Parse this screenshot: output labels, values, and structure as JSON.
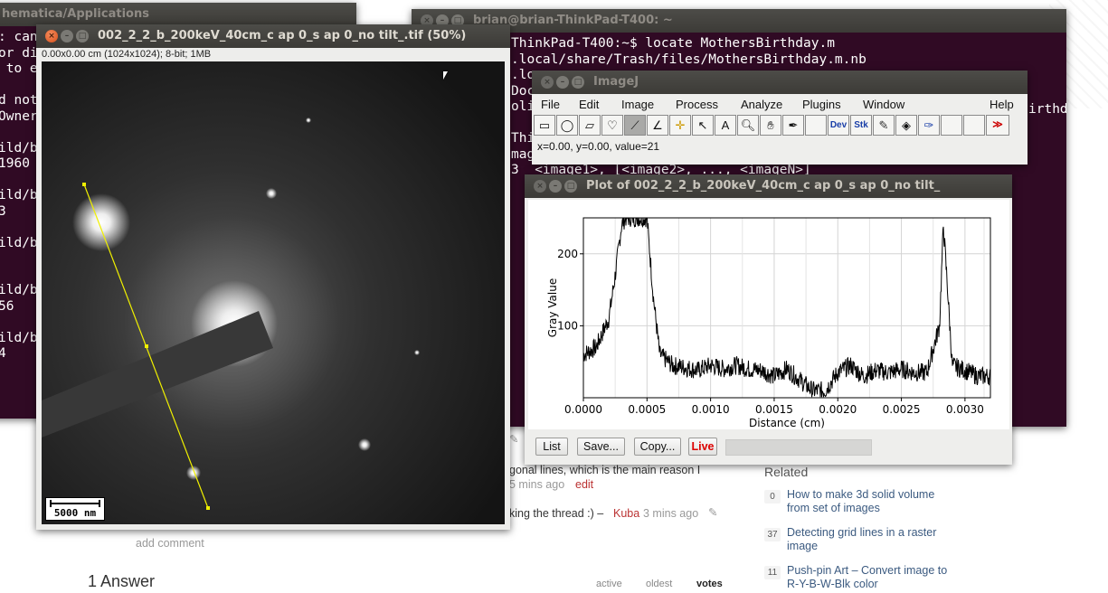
{
  "web": {
    "comment_fragment_1": "gonal lines, which is the main reason I",
    "comment_time_1": "5 mins ago",
    "comment_edit": "edit",
    "comment_fragment_2": "king the thread :) –",
    "comment_user_2": "Kuba",
    "comment_time_2": "3 mins ago",
    "add_comment": "add comment",
    "answers_heading": "1 Answer",
    "sort_tabs": [
      "active",
      "oldest",
      "votes"
    ],
    "related_heading": "Related",
    "related": [
      {
        "count": "0",
        "title": "How to make 3d solid volume from set of images"
      },
      {
        "count": "37",
        "title": "Detecting grid lines in a raster image"
      },
      {
        "count": "11",
        "title": "Push-pin Art – Convert image to R-Y-B-W-Blk color"
      }
    ]
  },
  "terminal_left": {
    "title": "hematica/Applications",
    "lines": [
      ": can",
      "or di",
      " to e",
      "",
      "d not",
      "Owner",
      "",
      "ild/b",
      "1960",
      "",
      "ild/b",
      "3",
      "",
      "ild/b",
      "",
      "",
      "ild/b",
      "56",
      "",
      "ild/b",
      "4"
    ]
  },
  "terminal_right": {
    "title": "brian@brian-ThinkPad-T400: ~",
    "lines": [
      "ThinkPad-T400:~$ locate MothersBirthday.m",
      ".local/share/Trash/files/MothersBirthday.m.nb",
      ".lo",
      "Doc",
      "oli",
      "",
      "Thi",
      "mag",
      "3  <image1>, [<image2>, ..., <imageN>]"
    ],
    "right_fragment": "irthd"
  },
  "image_window": {
    "title": "002_2_2_b_200keV_40cm_c ap 0_s ap 0_no tilt_.tif (50%)",
    "info": "0.00x0.00 cm (1024x1024); 8-bit; 1MB",
    "scale_bar": "5000 nm"
  },
  "imagej": {
    "title": "ImageJ",
    "menus": [
      "File",
      "Edit",
      "Image",
      "Process",
      "Analyze",
      "Plugins",
      "Window",
      "Help"
    ],
    "tools": [
      "rectangle-tool",
      "oval-tool",
      "polygon-tool",
      "freehand-tool",
      "line-tool",
      "angle-tool",
      "point-tool",
      "wand-tool",
      "text-tool",
      "magnifier-tool",
      "hand-tool",
      "dropper-tool",
      "",
      "dev-tool",
      "stk-tool",
      "brush-tool",
      "flood-fill-tool",
      "pencil-tool",
      "",
      "",
      "more-tools"
    ],
    "tool_labels": {
      "dev": "Dev",
      "stk": "Stk",
      "more": "≫"
    },
    "status": "x=0.00, y=0.00, value=21"
  },
  "plot_window": {
    "title": "Plot of 002_2_2_b_200keV_40cm_c ap 0_s ap 0_no tilt_",
    "buttons": {
      "list": "List",
      "save": "Save...",
      "copy": "Copy...",
      "live": "Live"
    }
  },
  "chart_data": {
    "type": "line",
    "xlabel": "Distance (cm)",
    "ylabel": "Gray Value",
    "xlim": [
      0.0,
      0.0032
    ],
    "ylim": [
      0,
      250
    ],
    "xticks": [
      "0.0000",
      "0.0005",
      "0.0010",
      "0.0015",
      "0.0020",
      "0.0025",
      "0.0030"
    ],
    "yticks": [
      "100",
      "200"
    ],
    "grid": true,
    "series": [
      {
        "x": [
          0.0,
          0.0001,
          0.0002,
          0.00025,
          0.0003,
          0.00033,
          0.00038,
          0.00045,
          0.0005,
          0.00055,
          0.0006,
          0.0007,
          0.0008,
          0.0009,
          0.001,
          0.0011,
          0.0012,
          0.0013,
          0.0014,
          0.0015,
          0.0016,
          0.0017,
          0.0018,
          0.0019,
          0.002,
          0.0021,
          0.0022,
          0.0023,
          0.0024,
          0.0025,
          0.0026,
          0.0027,
          0.0028,
          0.00283,
          0.00286,
          0.0029,
          0.003,
          0.0031,
          0.0032
        ],
        "y": [
          60,
          70,
          110,
          170,
          240,
          250,
          250,
          250,
          250,
          140,
          60,
          45,
          42,
          38,
          45,
          40,
          45,
          40,
          38,
          30,
          40,
          25,
          10,
          10,
          35,
          45,
          30,
          38,
          35,
          40,
          35,
          35,
          100,
          240,
          160,
          45,
          38,
          30,
          30
        ]
      }
    ]
  }
}
